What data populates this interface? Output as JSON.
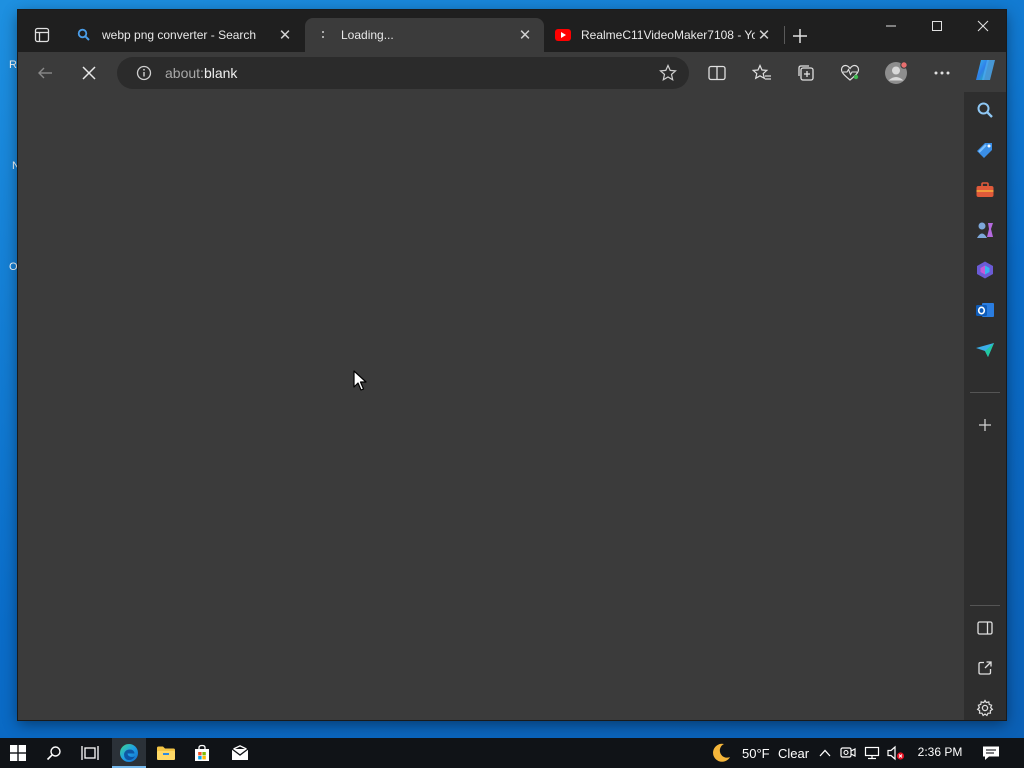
{
  "desktop": {
    "edge_fragments": [
      "R",
      "N",
      "O"
    ]
  },
  "browser": {
    "tabs": [
      {
        "title": "webp png converter - Search",
        "favicon": "search-icon",
        "close": "✕",
        "active": false
      },
      {
        "title": "Loading...",
        "favicon": "loading-icon",
        "close": "✕",
        "active": true
      },
      {
        "title": "RealmeC11VideoMaker7108 - Yo",
        "favicon": "youtube-icon",
        "close": "✕",
        "active": false
      }
    ],
    "address": {
      "prefix": "about:",
      "rest": "blank"
    },
    "colors": {
      "titlebar": "#1f1f1f",
      "toolbar": "#3b3b3b",
      "content": "#3b3b3b",
      "sidebar": "#2e2e2e",
      "accent": "#4a9de8"
    }
  },
  "sidebar": {
    "icons": [
      "search-icon",
      "shopping-tag-icon",
      "tools-icon",
      "games-icon",
      "office-icon",
      "outlook-icon",
      "send-icon",
      "add-icon",
      "split-pane-icon",
      "open-external-icon",
      "settings-icon"
    ]
  },
  "taskbar": {
    "weather": {
      "temp": "50°F",
      "condition": "Clear"
    },
    "clock": {
      "time": "2:36 PM"
    },
    "colors": {
      "background": "#101317",
      "active_underline": "#76b9ed"
    }
  }
}
